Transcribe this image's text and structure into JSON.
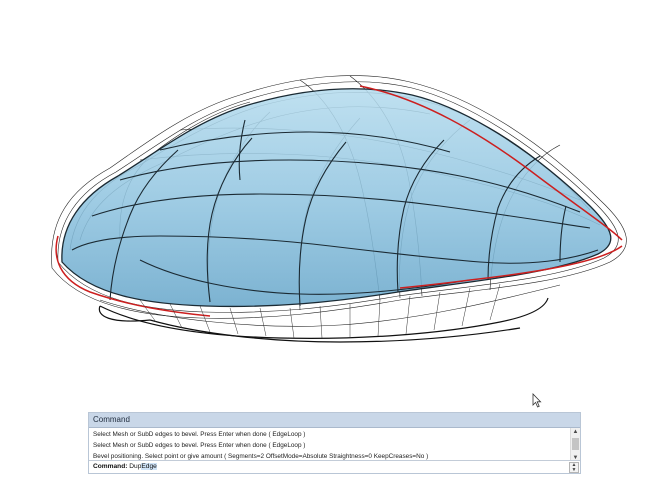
{
  "command_panel": {
    "title": "Command",
    "history": [
      "Select Mesh or SubD edges to bevel. Press Enter when done ( EdgeLoop )",
      "Select Mesh or SubD edges to bevel. Press Enter when done ( EdgeLoop )",
      "Bevel positioning. Select point or give amount ( Segments=2  OffsetMode=Absolute  Straightness=0  KeepCreases=No )"
    ],
    "prompt_label": "Command:",
    "input_typed": "Dup",
    "input_selected": "Edge"
  },
  "colors": {
    "model_fill": "#8fc4df",
    "model_edge": "#1b2a33",
    "highlight_edge": "#cc1f1f",
    "panel_header": "#c9d7e8"
  },
  "icons": {
    "cursor": "mouse-pointer-icon",
    "scroll_up": "chevron-up-icon",
    "scroll_down": "chevron-down-icon"
  }
}
